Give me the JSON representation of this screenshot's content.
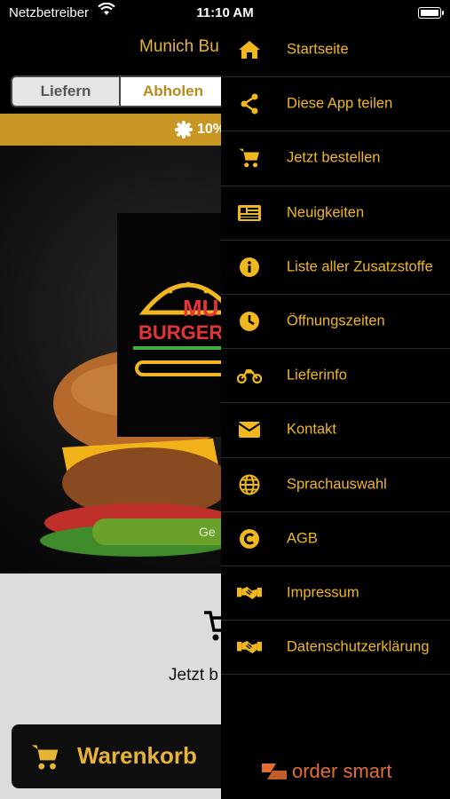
{
  "status_bar": {
    "carrier": "Netzbetreiber",
    "time": "11:10 AM"
  },
  "header": {
    "title": "Munich Bu"
  },
  "order_mode": {
    "options": [
      "Liefern",
      "Abholen"
    ],
    "selected": "Abholen"
  },
  "promo": {
    "text": "10%"
  },
  "hero": {
    "logo_text_1": "MU",
    "logo_text_2": "BURGER",
    "button_label": "Ge"
  },
  "order_prompt": {
    "text": "Jetzt b"
  },
  "cart_button": {
    "label": "Warenkorb"
  },
  "menu": {
    "items": [
      {
        "label": "Startseite",
        "icon": "home-icon"
      },
      {
        "label": "Diese App teilen",
        "icon": "share-icon"
      },
      {
        "label": "Jetzt bestellen",
        "icon": "cart-icon"
      },
      {
        "label": "Neuigkeiten",
        "icon": "newspaper-icon"
      },
      {
        "label": "Liste aller Zusatzstoffe",
        "icon": "info-icon"
      },
      {
        "label": "Öffnungszeiten",
        "icon": "clock-icon"
      },
      {
        "label": "Lieferinfo",
        "icon": "motorcycle-icon"
      },
      {
        "label": "Kontakt",
        "icon": "envelope-icon"
      },
      {
        "label": "Sprachauswahl",
        "icon": "globe-icon"
      },
      {
        "label": "AGB",
        "icon": "copyright-icon"
      },
      {
        "label": "Impressum",
        "icon": "handshake-icon"
      },
      {
        "label": "Datenschutzerklärung",
        "icon": "handshake-icon"
      }
    ]
  },
  "brand": {
    "name": "order smart"
  },
  "colors": {
    "accent": "#f0b81e",
    "promo_bar": "#c89622",
    "brand": "#e26d33",
    "drawer_bg": "#000000"
  }
}
